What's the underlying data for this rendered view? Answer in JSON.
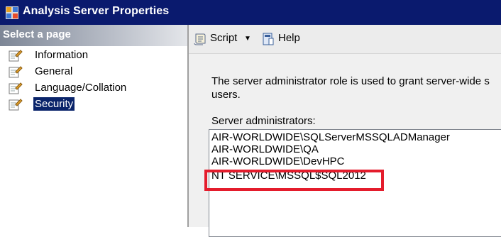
{
  "window": {
    "title": "Analysis Server Properties",
    "icon": "analysis-server-icon"
  },
  "sidebar": {
    "header": "Select a page",
    "items": [
      {
        "label": "Information",
        "icon": "page-wrench-icon",
        "selected": false
      },
      {
        "label": "General",
        "icon": "page-wrench-icon",
        "selected": false
      },
      {
        "label": "Language/Collation",
        "icon": "page-wrench-icon",
        "selected": false
      },
      {
        "label": "Security",
        "icon": "page-wrench-icon",
        "selected": true
      }
    ]
  },
  "toolbar": {
    "script_label": "Script",
    "help_label": "Help"
  },
  "main": {
    "description_line1": "The server administrator role is used to grant server-wide s",
    "description_line2": "users.",
    "admins_label": "Server administrators:",
    "admins": [
      "AIR-WORLDWIDE\\SQLServerMSSQLADManager",
      "AIR-WORLDWIDE\\QA",
      "AIR-WORLDWIDE\\DevHPC",
      "NT SERVICE\\MSSQL$SQL2012"
    ],
    "highlight_color": "#e41c2c"
  },
  "colors": {
    "titlebar": "#0a1a6e",
    "selection": "#0a246a"
  }
}
